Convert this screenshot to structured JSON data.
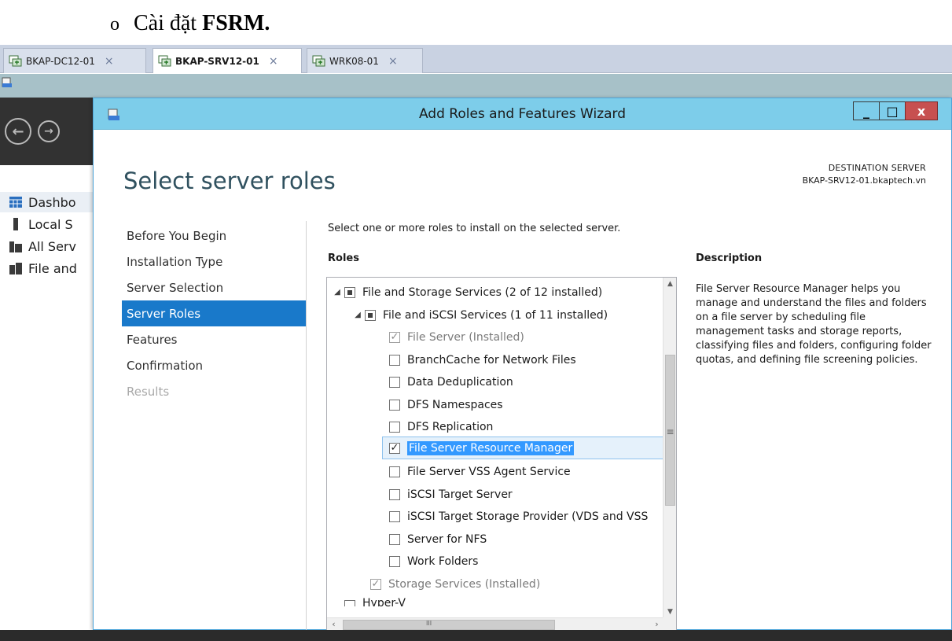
{
  "doc_heading": {
    "bullet": "o",
    "prefix": "Cài đặt ",
    "bold": "FSRM."
  },
  "vm_tabs": [
    {
      "label": "BKAP-DC12-01",
      "close": "×",
      "active": false
    },
    {
      "label": "BKAP-SRV12-01",
      "close": "×",
      "active": true
    },
    {
      "label": "WRK08-01",
      "close": "×",
      "active": false
    }
  ],
  "server_manager": {
    "nav_items": [
      {
        "label": "Dashbo",
        "icon": "dashboard-icon"
      },
      {
        "label": "Local S",
        "icon": "server-icon"
      },
      {
        "label": "All Serv",
        "icon": "servers-icon"
      },
      {
        "label": "File and",
        "icon": "file-storage-icon"
      }
    ]
  },
  "dialog": {
    "title": "Add Roles and Features Wizard",
    "window_buttons": {
      "minimize": "_",
      "maximize": "□",
      "close": "x"
    },
    "page_title": "Select server roles",
    "destination": {
      "label": "DESTINATION SERVER",
      "server": "BKAP-SRV12-01.bkaptech.vn"
    },
    "steps": [
      {
        "label": "Before You Begin",
        "state": "normal"
      },
      {
        "label": "Installation Type",
        "state": "normal"
      },
      {
        "label": "Server Selection",
        "state": "normal"
      },
      {
        "label": "Server Roles",
        "state": "active"
      },
      {
        "label": "Features",
        "state": "normal"
      },
      {
        "label": "Confirmation",
        "state": "normal"
      },
      {
        "label": "Results",
        "state": "disabled"
      }
    ],
    "instruction": "Select one or more roles to install on the selected server.",
    "roles_heading": "Roles",
    "description_heading": "Description",
    "roles": [
      {
        "label": "File and Storage Services (2 of 12 installed)",
        "level": 0,
        "expander": "◢",
        "check": "partial"
      },
      {
        "label": "File and iSCSI Services (1 of 11 installed)",
        "level": 1,
        "expander": "◢",
        "check": "partial"
      },
      {
        "label": "File Server (Installed)",
        "level": 2,
        "check": "checked-disabled"
      },
      {
        "label": "BranchCache for Network Files",
        "level": 2,
        "check": "unchecked"
      },
      {
        "label": "Data Deduplication",
        "level": 2,
        "check": "unchecked"
      },
      {
        "label": "DFS Namespaces",
        "level": 2,
        "check": "unchecked"
      },
      {
        "label": "DFS Replication",
        "level": 2,
        "check": "unchecked"
      },
      {
        "label": "File Server Resource Manager",
        "level": 2,
        "check": "checked",
        "selected": true
      },
      {
        "label": "File Server VSS Agent Service",
        "level": 2,
        "check": "unchecked"
      },
      {
        "label": "iSCSI Target Server",
        "level": 2,
        "check": "unchecked"
      },
      {
        "label": "iSCSI Target Storage Provider (VDS and VSS",
        "level": 2,
        "check": "unchecked"
      },
      {
        "label": "Server for NFS",
        "level": 2,
        "check": "unchecked"
      },
      {
        "label": "Work Folders",
        "level": 2,
        "check": "unchecked"
      },
      {
        "label": "Storage Services (Installed)",
        "level": 1,
        "check": "checked-disabled"
      },
      {
        "label": "Hyper-V",
        "level": 0,
        "check": "unchecked"
      }
    ],
    "description_text": "File Server Resource Manager helps you manage and understand the files and folders on a file server by scheduling file management tasks and storage reports, classifying files and folders, configuring folder quotas, and defining file screening policies.",
    "scroll_grips": {
      "vertical": "≡",
      "horizontal": "III"
    }
  }
}
